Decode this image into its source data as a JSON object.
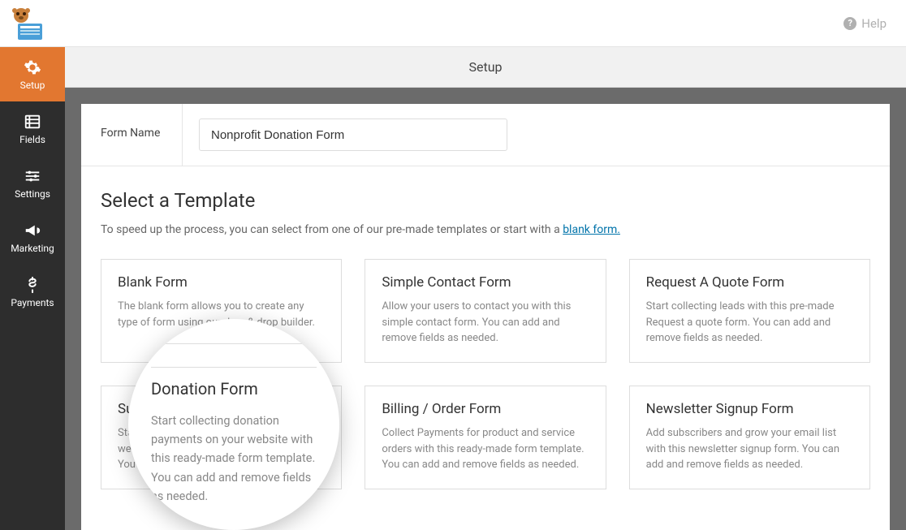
{
  "topbar": {
    "help_label": "Help"
  },
  "sidebar": {
    "items": [
      {
        "label": "Setup"
      },
      {
        "label": "Fields"
      },
      {
        "label": "Settings"
      },
      {
        "label": "Marketing"
      },
      {
        "label": "Payments"
      }
    ]
  },
  "page_title": "Setup",
  "form_name": {
    "label": "Form Name",
    "value": "Nonprofit Donation Form"
  },
  "template_section": {
    "heading": "Select a Template",
    "desc_before": "To speed up the process, you can select from one of our pre-made templates or start with a ",
    "link_text": "blank form.",
    "cards": [
      {
        "title": "Blank Form",
        "desc": "The blank form allows you to create any type of form using our drag & drop builder."
      },
      {
        "title": "Simple Contact Form",
        "desc": "Allow your users to contact you with this simple contact form. You can add and remove fields as needed."
      },
      {
        "title": "Request A Quote Form",
        "desc": "Start collecting leads with this pre-made Request a quote form. You can add and remove fields as needed."
      },
      {
        "title": "Suggestion Form",
        "desc": "Start collecting suggestions from your website visitors with this ready-made form. You can add and remove fields as needed."
      },
      {
        "title": "Billing / Order Form",
        "desc": "Collect Payments for product and service orders with this ready-made form template. You can add and remove fields as needed."
      },
      {
        "title": "Newsletter Signup Form",
        "desc": "Add subscribers and grow your email list with this newsletter signup form. You can add and remove fields as needed."
      }
    ]
  },
  "zoom": {
    "title": "Donation Form",
    "desc": "Start collecting donation payments on your website with this ready-made form template. You can add and remove fields as needed."
  }
}
